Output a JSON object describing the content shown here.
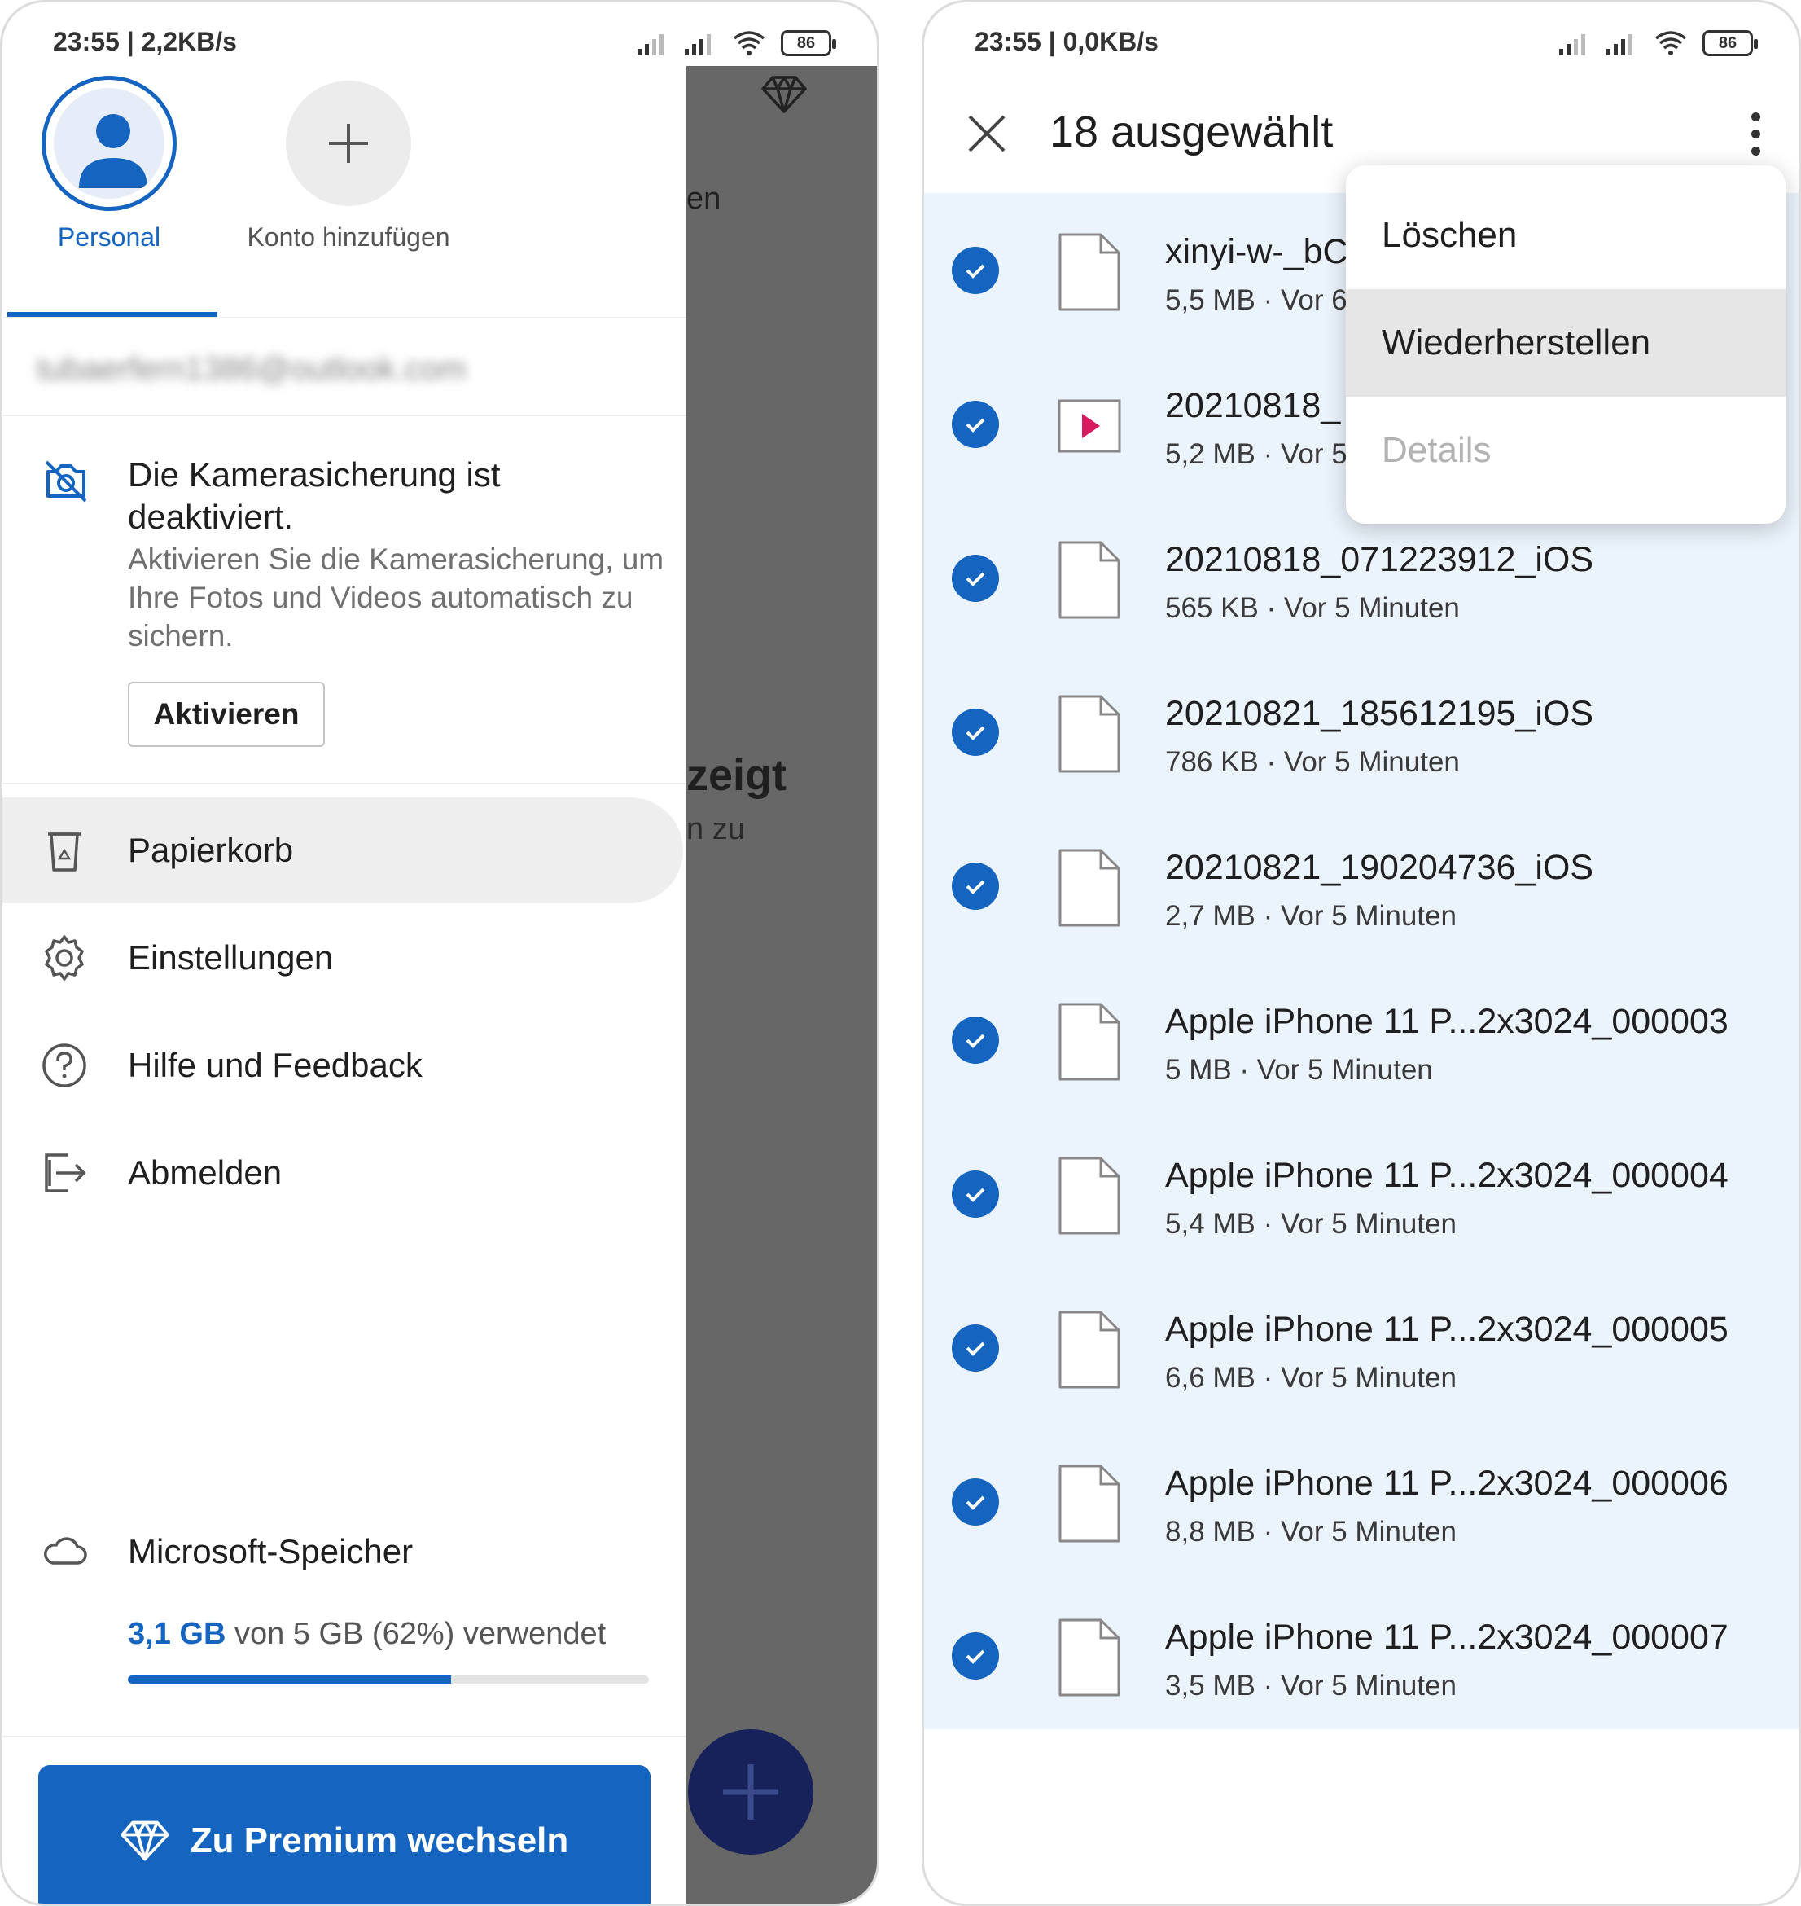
{
  "left_screen": {
    "status": {
      "time": "23:55 | 2,2KB/s",
      "battery": "86"
    },
    "accounts": [
      {
        "label": "Personal",
        "icon": "person-icon",
        "color": "#1565c0"
      },
      {
        "label": "Konto hinzufügen",
        "icon": "plus-icon",
        "color": "#555555"
      }
    ],
    "email": "tubaerfern1386@outlook.com",
    "camera_backup": {
      "title": "Die Kamerasicherung ist deaktiviert.",
      "body": "Aktivieren Sie die Kamerasicherung, um Ihre Fotos und Videos automatisch zu sichern.",
      "button": "Aktivieren"
    },
    "menu": [
      {
        "label": "Papierkorb",
        "icon": "recycle-bin-icon",
        "active": true
      },
      {
        "label": "Einstellungen",
        "icon": "gear-icon",
        "active": false
      },
      {
        "label": "Hilfe und Feedback",
        "icon": "help-icon",
        "active": false
      },
      {
        "label": "Abmelden",
        "icon": "sign-out-icon",
        "active": false
      }
    ],
    "storage": {
      "label": "Microsoft-Speicher",
      "used": "3,1 GB",
      "rest": " von 5 GB (62%) verwendet",
      "percent": 62
    },
    "premium_button": "Zu Premium wechseln",
    "background_peek": {
      "text1": "en",
      "text2": "zeigt",
      "text3": "n zu"
    }
  },
  "right_screen": {
    "status": {
      "time": "23:55 | 0,0KB/s",
      "battery": "86"
    },
    "appbar": {
      "title": "18 ausgewählt"
    },
    "files": [
      {
        "name": "xinyi-w-_bC",
        "meta": "5,5 MB · Vor 6",
        "type": "document"
      },
      {
        "name": "20210818_",
        "meta": "5,2 MB · Vor 5",
        "type": "video"
      },
      {
        "name": "20210818_071223912_iOS",
        "meta": "565 KB · Vor 5 Minuten",
        "type": "document"
      },
      {
        "name": "20210821_185612195_iOS",
        "meta": "786 KB · Vor 5 Minuten",
        "type": "document"
      },
      {
        "name": "20210821_190204736_iOS",
        "meta": "2,7 MB · Vor 5 Minuten",
        "type": "document"
      },
      {
        "name": "Apple iPhone 11 P...2x3024_000003",
        "meta": "5 MB · Vor 5 Minuten",
        "type": "document"
      },
      {
        "name": "Apple iPhone 11 P...2x3024_000004",
        "meta": "5,4 MB · Vor 5 Minuten",
        "type": "document"
      },
      {
        "name": "Apple iPhone 11 P...2x3024_000005",
        "meta": "6,6 MB · Vor 5 Minuten",
        "type": "document"
      },
      {
        "name": "Apple iPhone 11 P...2x3024_000006",
        "meta": "8,8 MB · Vor 5 Minuten",
        "type": "document"
      },
      {
        "name": "Apple iPhone 11 P...2x3024_000007",
        "meta": "3,5 MB · Vor 5 Minuten",
        "type": "document"
      }
    ],
    "context_menu": [
      {
        "label": "Löschen",
        "state": "normal"
      },
      {
        "label": "Wiederherstellen",
        "state": "hover"
      },
      {
        "label": "Details",
        "state": "disabled"
      }
    ]
  },
  "colors": {
    "accent": "#1565c0",
    "selected_list_bg": "#ebf3fc",
    "scrim": "#676767",
    "video_red": "#d81b60"
  }
}
